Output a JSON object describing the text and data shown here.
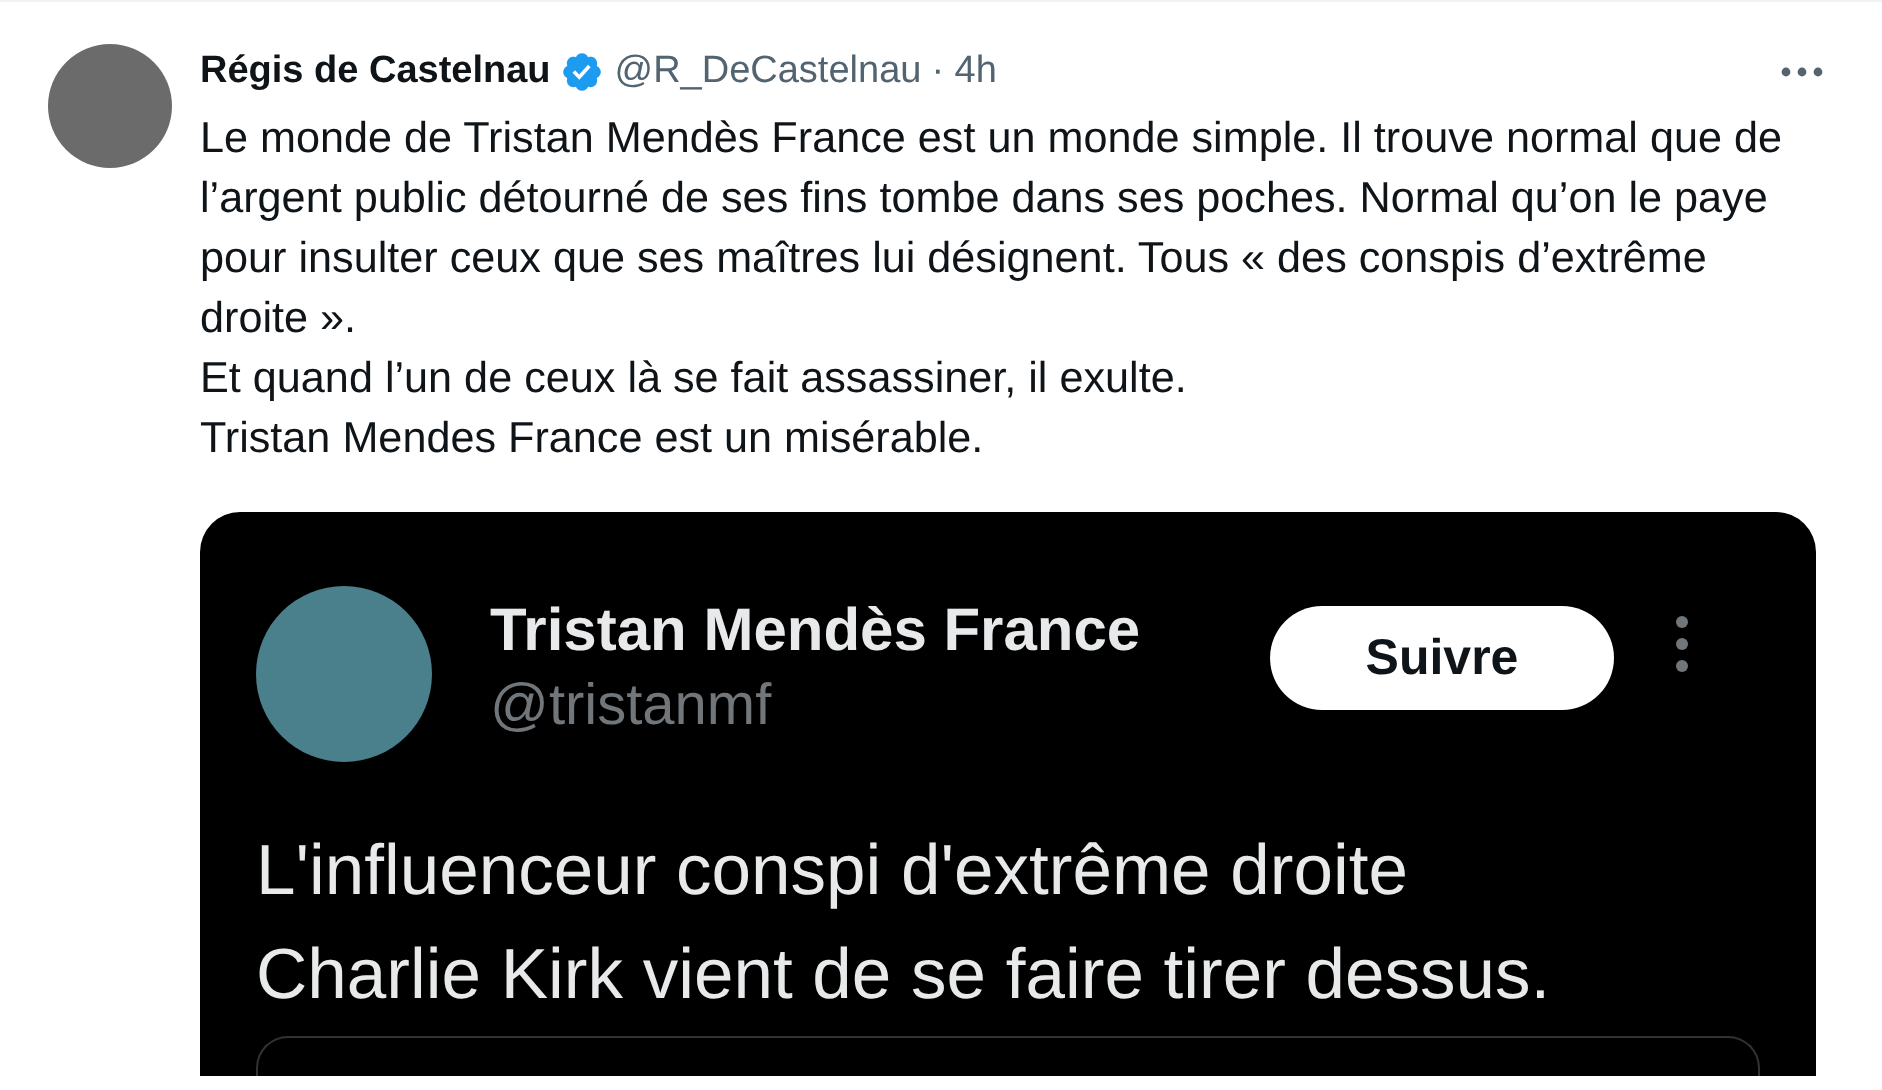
{
  "tweet": {
    "author": {
      "name": "Régis de Castelnau",
      "verified": true,
      "handle": "@R_DeCastelnau",
      "time": "· 4h"
    },
    "paragraphs": [
      "Le monde de Tristan Mendès France est un monde simple. Il trouve normal que de l’argent public détourné de ses fins tombe dans ses poches. Normal qu’on le paye pour insulter ceux que ses maîtres lui désignent. Tous « des conspis d’extrême droite ».",
      "Et quand l’un de ceux là se fait assassiner, il exulte.",
      "Tristan Mendes France est un misérable."
    ],
    "embedded_screenshot": {
      "name": "Tristan Mendès France",
      "handle": "@tristanmf",
      "follow_button": "Suivre",
      "text_lines": [
        "L'influenceur conspi d'extrême droite",
        "Charlie Kirk vient de se faire tirer dessus."
      ]
    }
  }
}
